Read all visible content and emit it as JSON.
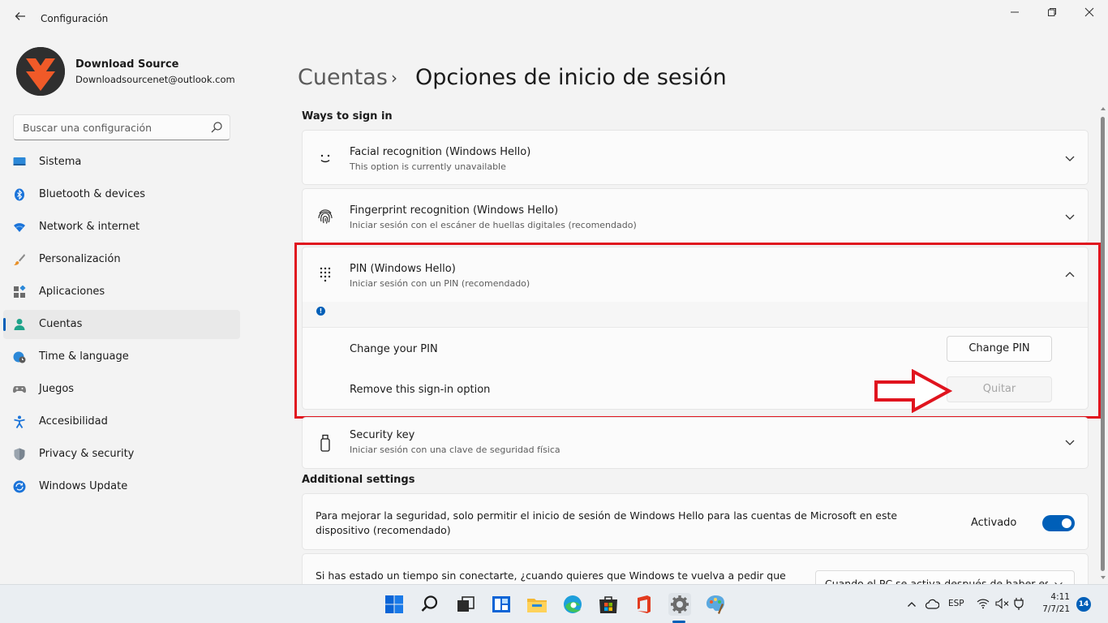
{
  "window": {
    "title": "Configuración",
    "back_icon": "arrow-left-icon",
    "controls": [
      "minimize-icon",
      "maximize-icon",
      "close-icon"
    ]
  },
  "profile": {
    "name": "Download Source",
    "email": "Downloadsourcenet@outlook.com",
    "avatar_colors": [
      "#2f2f2f",
      "#f05a28"
    ]
  },
  "search": {
    "placeholder": "Buscar una configuración",
    "value": ""
  },
  "nav": {
    "items": [
      {
        "label": "Sistema",
        "icon": "monitor-icon",
        "active": false
      },
      {
        "label": "Bluetooth & devices",
        "icon": "bluetooth-icon",
        "active": false
      },
      {
        "label": "Network & internet",
        "icon": "wifi-icon",
        "active": false
      },
      {
        "label": "Personalización",
        "icon": "brush-icon",
        "active": false
      },
      {
        "label": "Aplicaciones",
        "icon": "apps-icon",
        "active": false
      },
      {
        "label": "Cuentas",
        "icon": "person-icon",
        "active": true
      },
      {
        "label": "Time & language",
        "icon": "globe-clock-icon",
        "active": false
      },
      {
        "label": "Juegos",
        "icon": "gamepad-icon",
        "active": false
      },
      {
        "label": "Accesibilidad",
        "icon": "accessibility-icon",
        "active": false
      },
      {
        "label": "Privacy & security",
        "icon": "shield-icon",
        "active": false
      },
      {
        "label": "Windows Update",
        "icon": "update-icon",
        "active": false
      }
    ]
  },
  "breadcrumb": {
    "parent": "Cuentas",
    "separator": "›",
    "current": "Opciones de inicio de sesión"
  },
  "ways": {
    "heading": "Ways to sign in",
    "facial": {
      "title": "Facial recognition (Windows Hello)",
      "subtitle": "This option is currently unavailable"
    },
    "fingerprint": {
      "title": "Fingerprint recognition (Windows Hello)",
      "subtitle": "Iniciar sesión con el escáner de huellas digitales (recomendado)"
    },
    "pin": {
      "title": "PIN (Windows Hello)",
      "subtitle": "Iniciar sesión con un PIN (recomendado)",
      "change_label": "Change your PIN",
      "change_button": "Change PIN",
      "remove_label": "Remove this sign-in option",
      "remove_button": "Quitar"
    },
    "security_key": {
      "title": "Security key",
      "subtitle": "Iniciar sesión con una clave de seguridad física"
    }
  },
  "additional": {
    "heading": "Additional settings",
    "hello_only": {
      "text": "Para mejorar la seguridad, solo permitir el inicio de sesión de Windows Hello para las cuentas de Microsoft en este dispositivo (recomendado)",
      "state_label": "Activado",
      "on": true
    },
    "away": {
      "text": "Si has estado un tiempo sin conectarte, ¿cuando quieres que Windows te vuelva a pedir que",
      "dropdown_value": "Cuando el PC se activa después de haber es"
    }
  },
  "taskbar": {
    "apps": [
      "windows-start-icon",
      "search-icon",
      "task-view-icon",
      "widgets-icon",
      "file-explorer-icon",
      "edge-icon",
      "store-icon",
      "office-icon",
      "settings-icon",
      "paint-icon"
    ],
    "language": "ESP",
    "time": "4:11",
    "date": "7/7/21",
    "notifications": "14"
  },
  "colors": {
    "accent": "#005fb8",
    "highlight": "#e0141e"
  }
}
